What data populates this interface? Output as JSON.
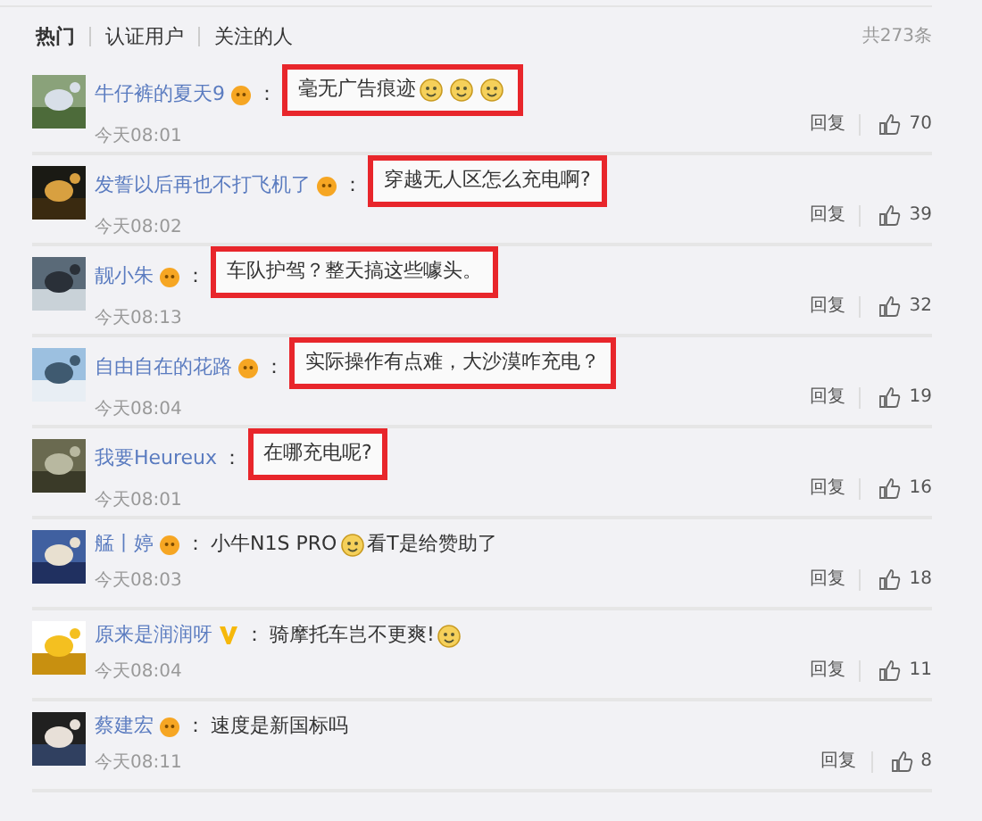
{
  "tabs": [
    {
      "label": "热门",
      "selected": true
    },
    {
      "label": "认证用户",
      "selected": false
    },
    {
      "label": "关注的人",
      "selected": false
    }
  ],
  "total": "共273条",
  "comments": [
    {
      "user": "牛仔裤的夏天9",
      "kind": "vip",
      "colon": "：",
      "highlighted": true,
      "parts": [
        {
          "kind": "text",
          "text": "毫无广告痕迹"
        },
        {
          "kind": "emoji"
        },
        {
          "kind": "emoji"
        },
        {
          "kind": "emoji"
        }
      ],
      "time": "今天08:01",
      "reply": "回复",
      "likes": "70"
    },
    {
      "user": "发誓以后再也不打飞机了",
      "kind": "vip",
      "colon": "：",
      "highlighted": true,
      "parts": [
        {
          "kind": "text",
          "text": "穿越无人区怎么充电啊?"
        }
      ],
      "time": "今天08:02",
      "reply": "回复",
      "likes": "39"
    },
    {
      "user": "靓小朱",
      "kind": "vip",
      "colon": "：",
      "highlighted": true,
      "parts": [
        {
          "kind": "text",
          "text": "车队护驾？整天搞这些噱头。"
        }
      ],
      "time": "今天08:13",
      "reply": "回复",
      "likes": "32"
    },
    {
      "user": "自由自在的花路",
      "kind": "vip",
      "colon": "：",
      "highlighted": true,
      "parts": [
        {
          "kind": "text",
          "text": "实际操作有点难，大沙漠咋充电？"
        }
      ],
      "time": "今天08:04",
      "reply": "回复",
      "likes": "19"
    },
    {
      "user": "我要Heureux",
      "kind": "plain",
      "colon": "：",
      "highlighted": true,
      "parts": [
        {
          "kind": "text",
          "text": "在哪充电呢?"
        }
      ],
      "time": "今天08:01",
      "reply": "回复",
      "likes": "16"
    },
    {
      "user": "艋丨婷",
      "kind": "vip",
      "colon": "：",
      "highlighted": false,
      "parts": [
        {
          "kind": "text",
          "text": "小牛N1S PRO"
        },
        {
          "kind": "emoji"
        },
        {
          "kind": "text",
          "text": "看T是给赞助了"
        }
      ],
      "time": "今天08:03",
      "reply": "回复",
      "likes": "18"
    },
    {
      "user": "原来是润润呀",
      "kind": "verified",
      "colon": "：",
      "highlighted": false,
      "parts": [
        {
          "kind": "text",
          "text": "骑摩托车岂不更爽!"
        },
        {
          "kind": "emoji"
        }
      ],
      "time": "今天08:04",
      "reply": "回复",
      "likes": "11"
    },
    {
      "user": "蔡建宏",
      "kind": "vip",
      "colon": "：",
      "highlighted": false,
      "parts": [
        {
          "kind": "text",
          "text": "速度是新国标吗"
        }
      ],
      "time": "今天08:11",
      "reply": "回复",
      "likes": "8"
    }
  ]
}
